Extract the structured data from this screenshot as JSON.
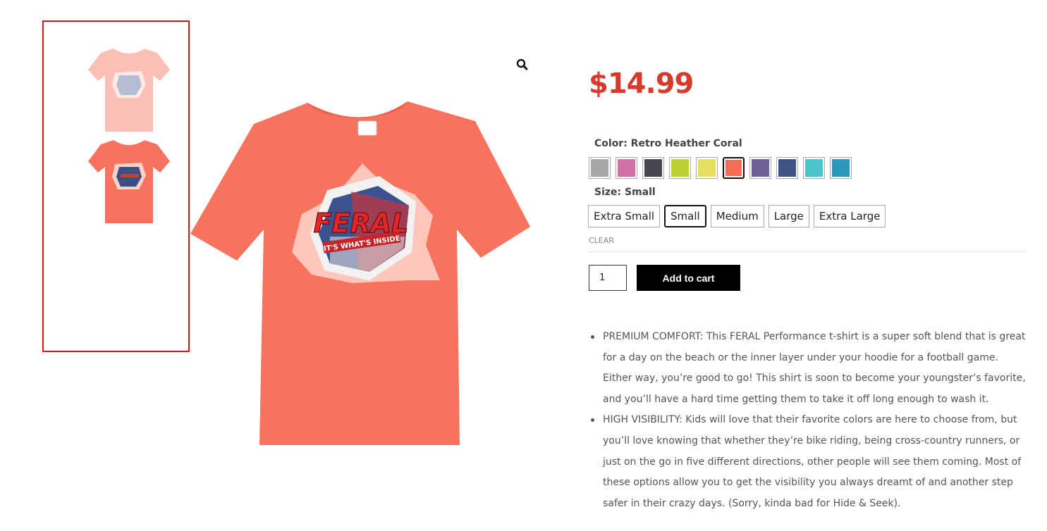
{
  "product": {
    "price": "$14.99",
    "color_label": "Color: Retro Heather Coral",
    "size_label": "Size: Small",
    "colors": [
      {
        "name": "gray",
        "hex": "#a6a7a9",
        "selected": false
      },
      {
        "name": "pink",
        "hex": "#cf72a6",
        "selected": false
      },
      {
        "name": "charcoal",
        "hex": "#47484f",
        "selected": false
      },
      {
        "name": "lime",
        "hex": "#b9cf34",
        "selected": false
      },
      {
        "name": "yellow",
        "hex": "#e6e061",
        "selected": false
      },
      {
        "name": "retro-heather-coral",
        "hex": "#f56d54",
        "selected": true
      },
      {
        "name": "purple",
        "hex": "#6d6096",
        "selected": false
      },
      {
        "name": "royal",
        "hex": "#3c5585",
        "selected": false
      },
      {
        "name": "aqua",
        "hex": "#48c6ca",
        "selected": false
      },
      {
        "name": "teal",
        "hex": "#2b97b9",
        "selected": false
      }
    ],
    "sizes": [
      {
        "label": "Extra Small",
        "selected": false
      },
      {
        "label": "Small",
        "selected": true
      },
      {
        "label": "Medium",
        "selected": false
      },
      {
        "label": "Large",
        "selected": false
      },
      {
        "label": "Extra Large",
        "selected": false
      }
    ],
    "clear_label": "CLEAR",
    "quantity": "1",
    "add_to_cart_label": "Add to cart"
  },
  "gallery": {
    "shirt_color": "#f7735e",
    "graphic_title": "FERAL",
    "graphic_subtitle": "IT'S WHAT'S INSIDE"
  },
  "description": [
    "PREMIUM COMFORT: This FERAL Performance t-shirt is a super soft blend that is great for a day on the beach or the inner layer under your hoodie for a football game.  Either way, you’re good to go! This shirt is soon to become your youngster’s favorite, and you’ll have a hard time getting them to take it off long enough to wash it.",
    "HIGH VISIBILITY: Kids will love that their favorite colors are here to choose from, but you’ll love knowing that whether they’re bike riding, being cross-country runners, or just on the go in five different directions, other people will see them coming.  Most of these options allow you to get the visibility you always dreamt of and another step safer in their crazy days. (Sorry, kinda bad for Hide & Seek)."
  ]
}
